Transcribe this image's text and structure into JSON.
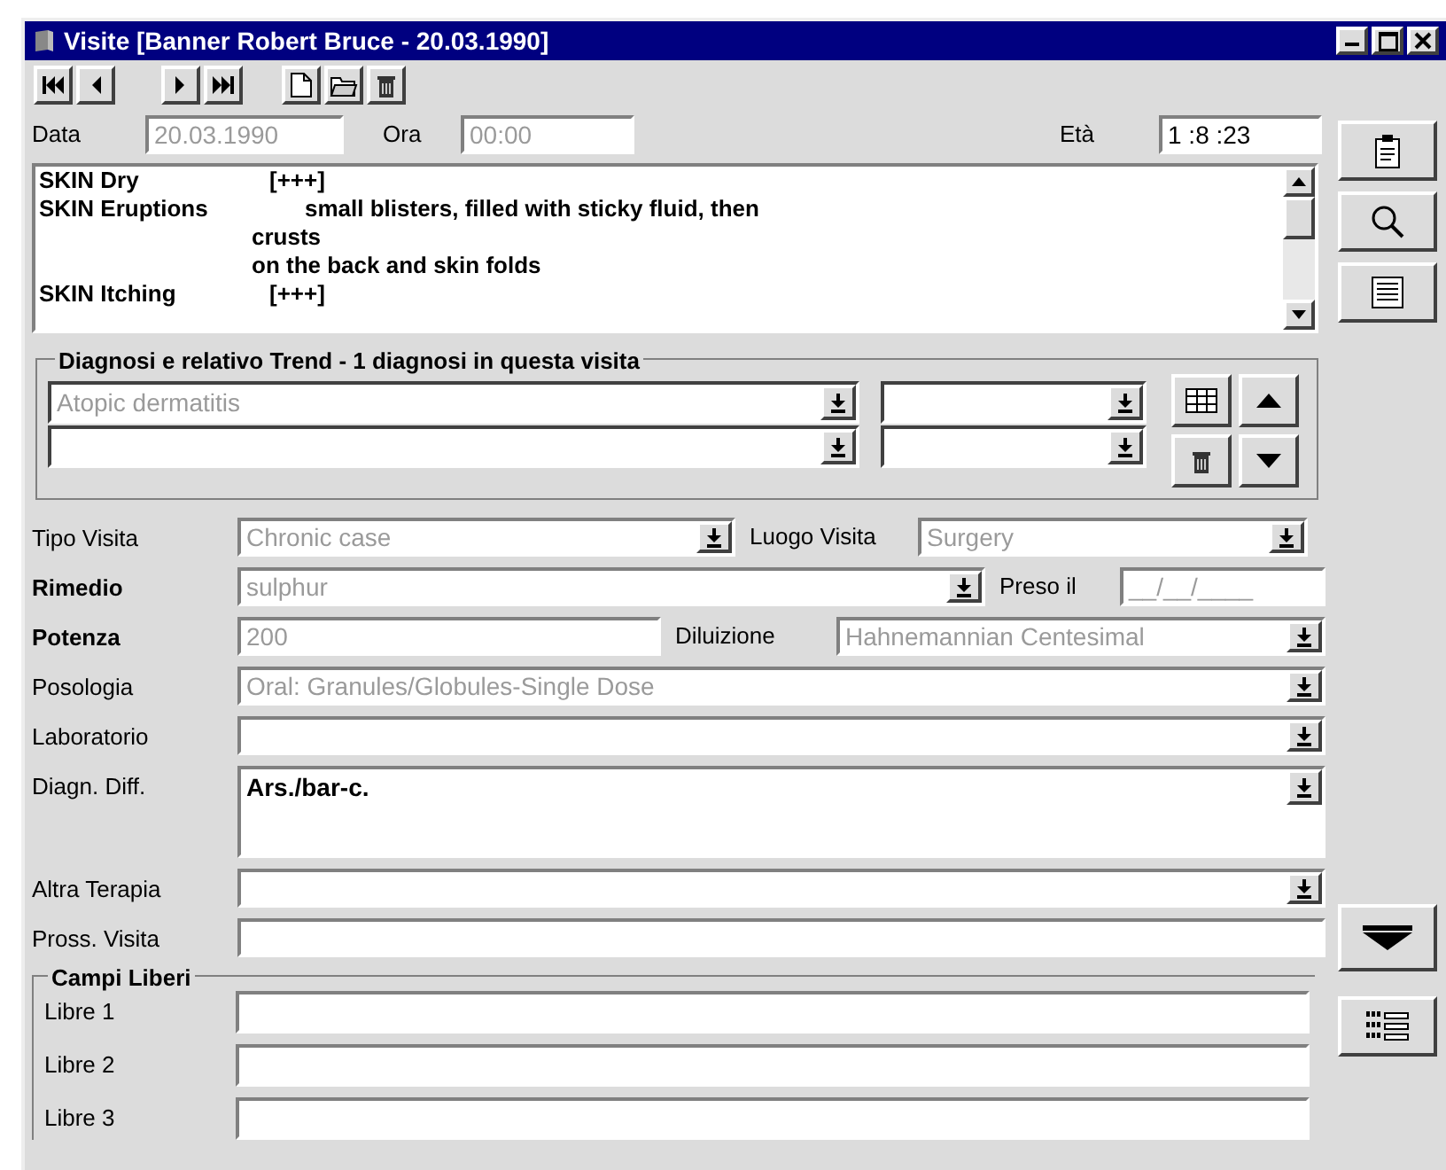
{
  "window": {
    "title": "Visite [Banner Robert Bruce - 20.03.1990]"
  },
  "header": [
    {
      "label": "Data",
      "value": "20.03.1990",
      "disabled": true
    },
    {
      "label": "Ora",
      "value": "00:00",
      "disabled": true
    },
    {
      "label": "Età",
      "value": "1 :8 :23",
      "disabled": false
    }
  ],
  "notes": [
    {
      "symptom": "SKIN Dry",
      "lines": [
        "[+++]"
      ]
    },
    {
      "symptom": "SKIN Eruptions",
      "lines": [
        "small blisters, filled with sticky fluid, then",
        "crusts",
        "on the back and skin folds"
      ]
    },
    {
      "symptom": "SKIN Itching",
      "lines": [
        "[+++]"
      ]
    }
  ],
  "diagnosis_group": {
    "title": "Diagnosi e relativo Trend - 1 diagnosi in questa visita",
    "rows": [
      {
        "diagnosis": "Atopic dermatitis",
        "disabled": true
      },
      {}
    ]
  },
  "form_rows": [
    [
      {
        "label": "Tipo Visita",
        "bold": false,
        "kind": "combo",
        "value": "Chronic case",
        "disabled": true
      },
      {
        "label": "Luogo Visita",
        "bold": false,
        "kind": "combo",
        "value": "Surgery",
        "disabled": true
      }
    ],
    [
      {
        "label": "Rimedio",
        "bold": true,
        "kind": "combo",
        "value": "sulphur",
        "disabled": true
      },
      {
        "label": "Preso il",
        "bold": false,
        "kind": "text",
        "value": "__/__/____",
        "disabled": true
      }
    ],
    [
      {
        "label": "Potenza",
        "bold": true,
        "kind": "text",
        "value": "200",
        "disabled": true
      },
      {
        "label": "Diluizione",
        "bold": false,
        "kind": "combo",
        "value": "Hahnemannian Centesimal",
        "disabled": true
      }
    ],
    [
      {
        "label": "Posologia",
        "bold": false,
        "kind": "combo",
        "value": "Oral: Granules/Globules-Single Dose",
        "disabled": true
      }
    ],
    [
      {
        "label": "Laboratorio",
        "bold": false,
        "kind": "combo"
      }
    ],
    [
      {
        "label": "Diagn. Diff.",
        "bold": false,
        "kind": "memo",
        "value": "Ars./bar-c.",
        "disabled": false
      }
    ],
    [
      {
        "label": "Altra Terapia",
        "bold": false,
        "kind": "combo"
      }
    ],
    [
      {
        "label": "Pross. Visita",
        "bold": false,
        "kind": "text"
      }
    ]
  ],
  "free_fields": {
    "title": "Campi Liberi",
    "fields": [
      {
        "label": "Libre 1"
      },
      {
        "label": "Libre 2"
      },
      {
        "label": "Libre 3"
      }
    ]
  }
}
